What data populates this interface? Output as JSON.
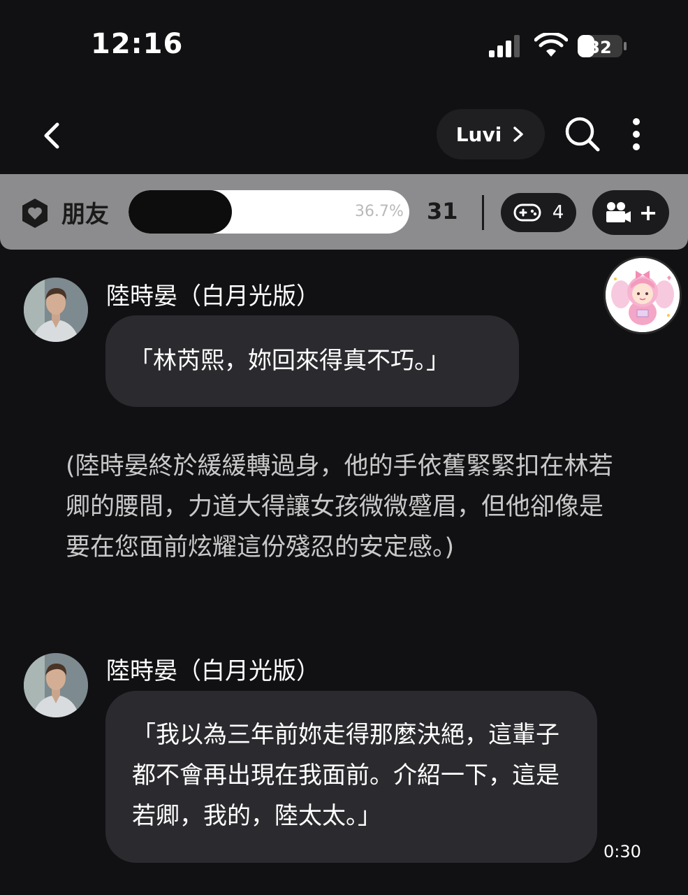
{
  "status_bar": {
    "time": "12:16",
    "battery": "32"
  },
  "header": {
    "character_pill": "Luvi"
  },
  "relationship": {
    "label": "朋友",
    "progress_percent": 36.7,
    "progress_text": "36.7%",
    "score": "31",
    "game_count": "4",
    "add_label": "+"
  },
  "messages": [
    {
      "sender": "陸時晏（白月光版）",
      "text": "「林芮熙，妳回來得真不巧。」"
    },
    {
      "narration": "(陸時晏終於緩緩轉過身，他的手依舊緊緊扣在林若卿的腰間，力道大得讓女孩微微蹙眉，但他卻像是要在您面前炫耀這份殘忍的安定感。)"
    },
    {
      "sender": "陸時晏（白月光版）",
      "text": "「我以為三年前妳走得那麼決絕，這輩子都不會再出現在我面前。介紹一下，這是若卿，我的，陸太太。」",
      "time": "0:30"
    }
  ]
}
